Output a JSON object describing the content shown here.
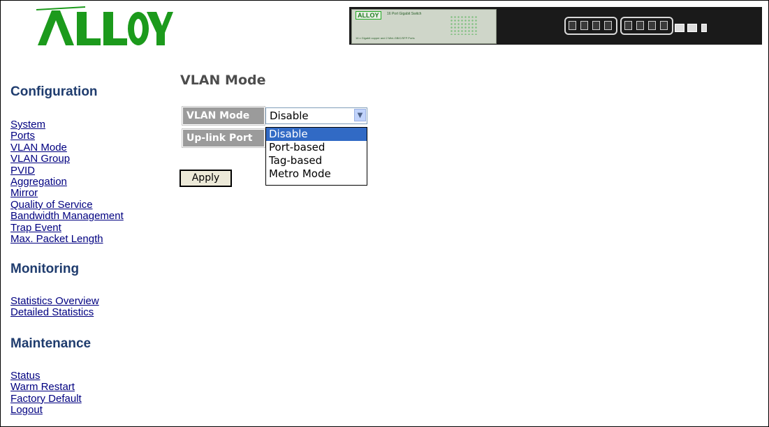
{
  "logo": {
    "text": "ALLOY",
    "color": "#1c9a1c"
  },
  "device_banner": {
    "brand": "ALLOY",
    "model": "16 Port Gigabit Switch",
    "subtitle": "16 x Gigabit copper and 2 Mini-GBIC/SFP Ports"
  },
  "sidebar": {
    "sections": [
      {
        "title": "Configuration",
        "items": [
          "System",
          "Ports",
          "VLAN Mode",
          "VLAN Group",
          "PVID",
          "Aggregation",
          "Mirror",
          "Quality of Service",
          "Bandwidth Management",
          "Trap Event",
          "Max. Packet Length"
        ]
      },
      {
        "title": "Monitoring",
        "items": [
          "Statistics Overview",
          "Detailed Statistics"
        ]
      },
      {
        "title": "Maintenance",
        "items": [
          "Status",
          "Warm Restart",
          "Factory Default",
          "Logout"
        ]
      }
    ]
  },
  "main": {
    "title": "VLAN Mode",
    "form": {
      "vlan_mode_label": "VLAN Mode",
      "uplink_port_label": "Up-link Port",
      "vlan_mode_value": "Disable",
      "options": [
        "Disable",
        "Port-based",
        "Tag-based",
        "Metro Mode"
      ],
      "highlighted_option": "Disable",
      "apply_label": "Apply"
    }
  },
  "colors": {
    "section_title": "#1f3c6e",
    "link": "#000080",
    "label_bg": "#9b9b9b",
    "highlight": "#316ac5"
  }
}
